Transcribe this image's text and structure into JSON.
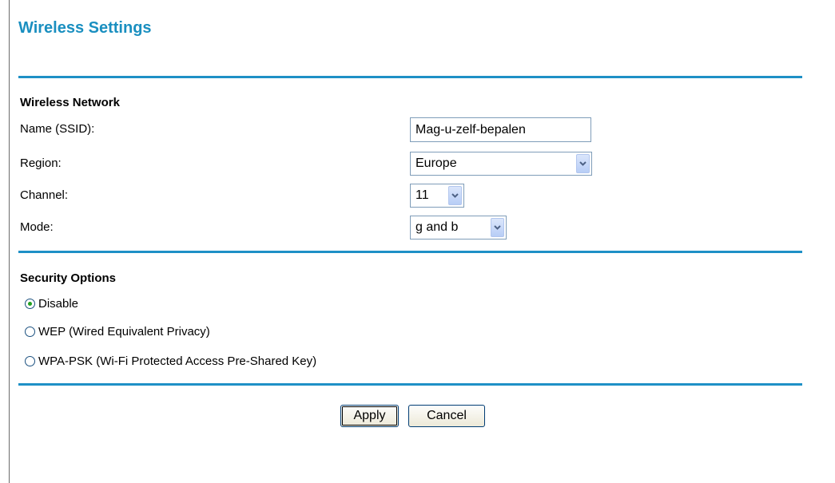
{
  "page": {
    "title": "Wireless Settings"
  },
  "wireless_network": {
    "heading": "Wireless Network",
    "ssid_label": "Name (SSID):",
    "ssid_value": "Mag-u-zelf-bepalen",
    "region_label": "Region:",
    "region_value": "Europe",
    "channel_label": "Channel:",
    "channel_value": "11",
    "mode_label": "Mode:",
    "mode_value": "g and b"
  },
  "security": {
    "heading": "Security Options",
    "options": [
      {
        "label": "Disable",
        "selected": true
      },
      {
        "label": "WEP (Wired Equivalent Privacy)",
        "selected": false
      },
      {
        "label": "WPA-PSK (Wi-Fi Protected Access Pre-Shared Key)",
        "selected": false
      }
    ]
  },
  "actions": {
    "apply_label": "Apply",
    "cancel_label": "Cancel"
  },
  "colors": {
    "title": "#1a8fc0",
    "rule": "#1e90c6",
    "radio_selected": "#21a121"
  },
  "icons": {
    "dropdown": "chevron-down-icon",
    "radio": "radio-button-icon"
  }
}
